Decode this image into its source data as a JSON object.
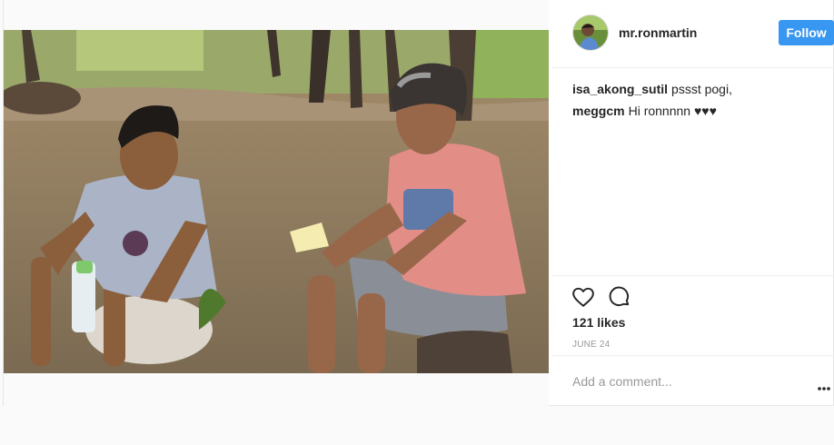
{
  "post": {
    "username": "mr.ronmartin",
    "follow_label": "Follow",
    "likes": "121 likes",
    "date": "JUNE 24",
    "add_comment_placeholder": "Add a comment...",
    "comments": [
      {
        "author": "isa_akong_sutil",
        "text": "pssst pogi,"
      },
      {
        "author": "meggcm",
        "text": "Hi ronnnnn ♥♥♥"
      }
    ]
  },
  "icons": {
    "like": "heart-icon",
    "comment": "comment-icon",
    "more": "more-options-icon"
  },
  "colors": {
    "follow_button": "#3897f0",
    "username": "#262626",
    "muted": "#999999",
    "divider": "#efefef"
  }
}
